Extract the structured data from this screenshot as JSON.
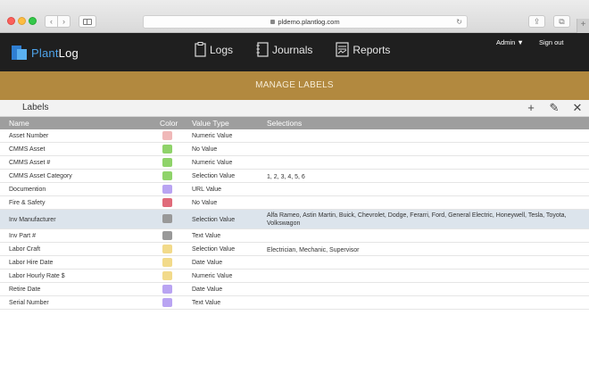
{
  "browser": {
    "url": "pldemo.plantlog.com",
    "nav_back": "‹",
    "nav_forward": "›",
    "reload": "↻",
    "share": "⇪",
    "tabs": "⧉",
    "new_tab": "+"
  },
  "header": {
    "logo_word_a": "Plant",
    "logo_word_b": "Log",
    "nav": [
      "Logs",
      "Journals",
      "Reports"
    ],
    "admin_label": "Admin ▼",
    "signout_label": "Sign out"
  },
  "band": {
    "title": "MANAGE LABELS"
  },
  "panel": {
    "title": "Labels",
    "add_icon": "+",
    "edit_icon": "✎",
    "close_icon": "✕"
  },
  "table": {
    "columns": [
      "Name",
      "Color",
      "Value Type",
      "Selections"
    ],
    "rows": [
      {
        "name": "Asset Number",
        "color": "#f0b8b8",
        "type": "Numeric Value",
        "selections": ""
      },
      {
        "name": "CMMS Asset",
        "color": "#8fd36a",
        "type": "No Value",
        "selections": ""
      },
      {
        "name": "CMMS Asset #",
        "color": "#8fd36a",
        "type": "Numeric Value",
        "selections": ""
      },
      {
        "name": "CMMS Asset Category",
        "color": "#8fd36a",
        "type": "Selection Value",
        "selections": "1, 2, 3, 4, 5, 6"
      },
      {
        "name": "Documention",
        "color": "#b9a4f2",
        "type": "URL Value",
        "selections": ""
      },
      {
        "name": "Fire & Safety",
        "color": "#e06b7a",
        "type": "No Value",
        "selections": ""
      },
      {
        "name": "Inv Manufacturer",
        "color": "#999999",
        "type": "Selection Value",
        "selections": "Alfa Rameo, Astin Martin, Buick, Chevrolet, Dodge, Ferarri, Ford, General Electric, Honeywell, Tesla, Toyota, Volkswagon"
      },
      {
        "name": "Inv Part #",
        "color": "#999999",
        "type": "Text Value",
        "selections": ""
      },
      {
        "name": "Labor Craft",
        "color": "#f2da8a",
        "type": "Selection Value",
        "selections": "Electrician, Mechanic, Supervisor"
      },
      {
        "name": "Labor Hire Date",
        "color": "#f2da8a",
        "type": "Date Value",
        "selections": ""
      },
      {
        "name": "Labor Hourly Rate $",
        "color": "#f2da8a",
        "type": "Numeric Value",
        "selections": ""
      },
      {
        "name": "Retire Date",
        "color": "#b9a4f2",
        "type": "Date Value",
        "selections": ""
      },
      {
        "name": "Serial Number",
        "color": "#b9a4f2",
        "type": "Text Value",
        "selections": ""
      }
    ]
  }
}
